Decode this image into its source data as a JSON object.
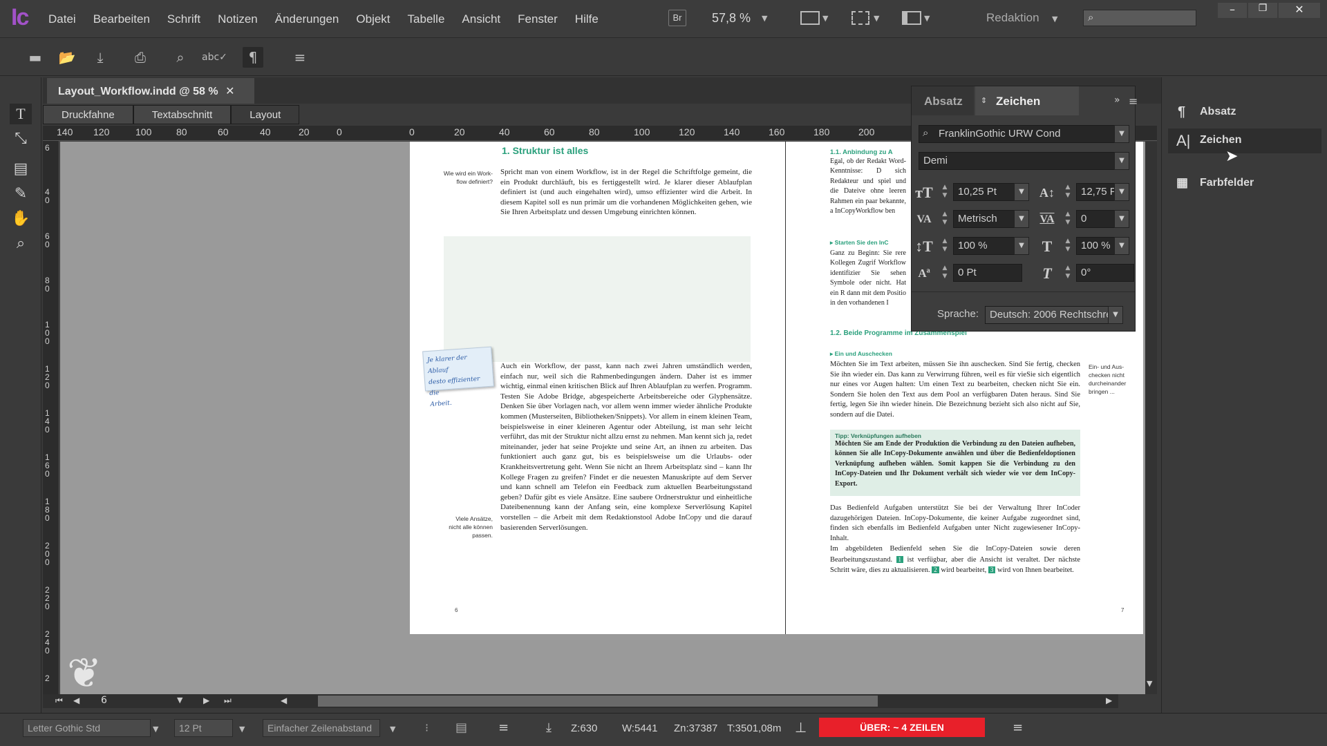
{
  "app": {
    "logo": "Ic",
    "menu": [
      "Datei",
      "Bearbeiten",
      "Schrift",
      "Notizen",
      "Änderungen",
      "Objekt",
      "Tabelle",
      "Ansicht",
      "Fenster",
      "Hilfe"
    ],
    "bridge": "Br",
    "zoom": "57,8 %",
    "workspace": "Redaktion"
  },
  "document": {
    "tab_title": "Layout_Workflow.indd @ 58 %",
    "views": [
      "Druckfahne",
      "Textabschnitt",
      "Layout"
    ]
  },
  "rulers": {
    "h_left": [
      "140",
      "120",
      "100",
      "80",
      "60",
      "40",
      "20",
      "0"
    ],
    "h_right": [
      "0",
      "20",
      "40",
      "60",
      "80",
      "100",
      "120",
      "140",
      "160",
      "180",
      "200"
    ],
    "v": [
      "6",
      "4 0",
      "6 0",
      "8 0",
      "1 0 0",
      "1 2 0",
      "1 4 0",
      "1 6 0",
      "1 8 0",
      "2 0 0",
      "2 2 0",
      "2 4 0",
      "2"
    ]
  },
  "page_left": {
    "heading": "1.  Struktur ist alles",
    "side_note1": "Wie wird ein Work-\nflow definiert?",
    "para1": "Spricht man von einem Workflow, ist in der Regel die Schriftfolge gemeint, die ein Produkt durchläuft, bis es fertiggestellt wird. Je klarer dieser Ablaufplan definiert ist (und auch eingehalten wird), umso effizienter wird die Arbeit. In diesem Kapitel soll es nun primär um die vorhandenen Möglichkeiten gehen, wie Sie Ihren Arbeitsplatz und dessen Umgebung einrichten können.",
    "sticky": "Je klarer der Ablauf\ndesto effizienter die\nArbeit.",
    "para2": "Auch ein Workflow, der passt, kann nach zwei Jahren umständlich werden, einfach nur, weil sich die Rahmenbedingungen ändern. Daher ist es immer wichtig, einmal einen kritischen Blick auf Ihren Ablaufplan zu werfen. Programm. Testen Sie Adobe Bridge, abgespeicherte Arbeitsbereiche oder Glyphensätze. Denken Sie über Vorlagen nach, vor allem wenn immer wieder ähnliche Produkte kommen (Musterseiten, Bibliotheken/Snippets). Vor allem in einem kleinen Team, beispielsweise in einer kleineren Agentur oder Abteilung, ist man sehr leicht verführt, das mit der Struktur nicht allzu ernst zu nehmen. Man kennt sich ja, redet miteinander, jeder hat seine Projekte und seine Art, an ihnen zu arbeiten. Das funktioniert auch ganz gut, bis es beispielsweise um die Urlaubs- oder Krankheitsvertretung geht. Wenn Sie nicht an Ihrem Arbeitsplatz sind – kann Ihr Kollege Fragen zu greifen? Findet er die neuesten Manuskripte auf dem Server und kann schnell am Telefon ein Feedback zum aktuellen Bearbeitungsstand geben? Dafür gibt es viele Ansätze. Eine saubere Ordnerstruktur und einheitliche Dateibenennung kann der Anfang sein, eine komplexe Serverlösung Kapitel vorstellen – die Arbeit mit dem Redaktionstool Adobe InCopy und die darauf basierenden Serverlösungen.",
    "side_note2": "Viele Ansätze,\nnicht alle können\npassen.",
    "page_no": "6"
  },
  "page_right": {
    "h1": "1.1.  Anbindung zu A",
    "para1": "Egal, ob der Redakt Word-Kenntnisse: D sich Redakteur und spiel und die Dateive ohne leeren Rahmen ein paar bekannte, a InCopyWorkflow ben",
    "sub1": "▸  Starten Sie den InC",
    "para2": "Ganz zu Beginn: Sie rere Kollegen Zugrif Workflow identifizier Sie sehen Symbole oder nicht. Hat ein R dann mit dem Positio in den vorhandenen I",
    "h2": "1.2.  Beide Programme im Zusammenspiel",
    "sub2": "▸  Ein und Auschecken",
    "para3": "Möchten Sie im Text arbeiten, müssen Sie ihn auschecken. Sind Sie fertig, checken Sie ihn wieder ein. Das kann zu Verwirrung führen, weil es für vieSie sich eigentlich nur eines vor Augen halten: Um einen Text zu bearbeiten, checken nicht Sie ein. Sondern Sie holen den Text aus dem Pool an verfügbaren Daten heraus. Sind Sie fertig, legen Sie ihn wieder hinein. Die Bezeichnung bezieht sich also nicht auf Sie, sondern auf die Datei.",
    "side_note": "Ein- und Aus-\nchecken nicht\ndurcheinander\nbringen ...",
    "tip_title": "Tipp: Verknüpfungen aufheben",
    "tip_text": "Möchten Sie am Ende der Produktion die Verbindung zu den Dateien aufheben, können Sie alle InCopy-Dokumente anwählen und über die Bedienfeldoptionen Verknüpfung aufheben wählen. Somit kappen Sie die Verbindung zu den InCopy-Dateien und Ihr Dokument verhält sich wieder wie vor dem InCopy-Export.",
    "para4": "Das Bedienfeld Aufgaben unterstützt Sie bei der Verwaltung Ihrer InCoder dazugehörigen Dateien. InCopy-Dokumente, die keiner Aufgabe zugeordnet sind, finden sich ebenfalls im Bedienfeld Aufgaben unter Nicht zugewiesener InCopy-Inhalt.",
    "para5": "Im abgebildeten Bedienfeld sehen Sie die InCopy-Dateien sowie deren Bearbeitungszustand.",
    "badge1": "1",
    "para5b": "ist verfügbar, aber die Ansicht ist veraltet. Der nächste Schritt wäre, dies zu aktualisieren.",
    "badge2": "2",
    "para5c": "wird bearbeitet,",
    "badge3": "3",
    "para5d": "wird von Ihnen bearbeitet.",
    "page_no": "7"
  },
  "panel": {
    "tab_absatz": "Absatz",
    "tab_zeichen": "Zeichen",
    "font": "FranklinGothic URW Cond",
    "style": "Demi",
    "size": "10,25 Pt",
    "leading": "12,75 Pt",
    "kerning": "Metrisch",
    "tracking": "0",
    "vscale": "100 %",
    "hscale": "100 %",
    "baseline": "0 Pt",
    "skew": "0°",
    "language_label": "Sprache:",
    "language": "Deutsch: 2006 Rechtschre..."
  },
  "dock": {
    "items": [
      "Absatz",
      "Zeichen",
      "Farbfelder"
    ]
  },
  "nav": {
    "page": "6"
  },
  "status": {
    "font": "Letter Gothic Std",
    "size": "12 Pt",
    "spacing": "Einfacher Zeilenabstand",
    "z": "Z:630",
    "w": "W:5441",
    "zn": "Zn:37387",
    "t": "T:3501,08m",
    "overset": "ÜBER:  ~ 4 ZEILEN"
  },
  "colors": {
    "accent": "#a252c8",
    "green": "#2aa07c",
    "overset": "#e8202a"
  }
}
